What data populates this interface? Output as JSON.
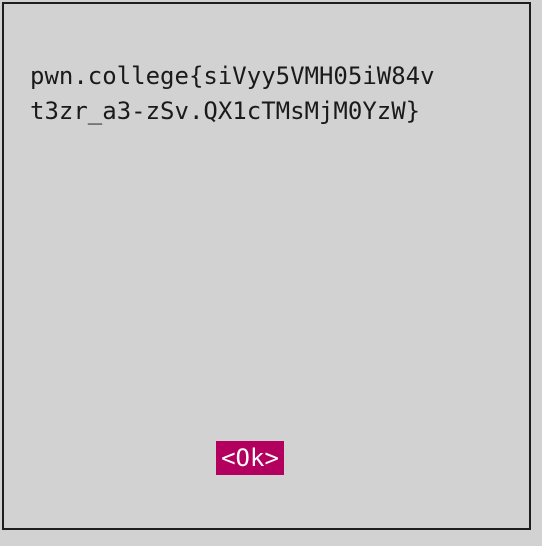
{
  "dialog": {
    "message_lines": [
      "pwn.college{siVyy5VMH05iW84v",
      "t3zr_a3-zSv.QX1cTMsMjM0YzW}"
    ],
    "ok_label": "<Ok>"
  },
  "colors": {
    "background": "#d2d2d2",
    "border": "#1e1e1e",
    "text": "#1a1a1a",
    "button_bg": "#b3005e",
    "button_text": "#ffffff"
  }
}
